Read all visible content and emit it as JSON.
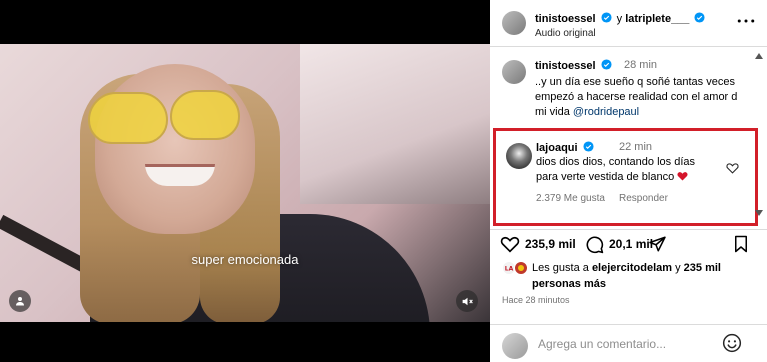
{
  "video": {
    "caption": "super emocionada",
    "user_button_icon": "user-icon",
    "mute_button_icon": "muted-speaker-icon"
  },
  "header": {
    "account_primary": "tinistoessel",
    "connector": "y",
    "account_secondary": "latriplete___",
    "audio": "Audio original",
    "more_icon": "more-horizontal-icon"
  },
  "caption_comment": {
    "username": "tinistoessel",
    "time": "28 min",
    "text": "..y un día ese sueño q soñé tantas veces empezó a hacerse realidad con el amor d mi vida",
    "mention": "@rodridepaul"
  },
  "highlighted_comment": {
    "username": "lajoaqui",
    "time": "22 min",
    "text": "dios dios dios, contando los días para verte vestida de blanco",
    "likes": "2.379 Me gusta",
    "reply_label": "Responder",
    "highlight_color": "#d21f29"
  },
  "actions": {
    "likes_count": "235,9 mil",
    "comments_count": "20,1 mil"
  },
  "likes_summary": {
    "prefix": "Les gusta a",
    "user": "elejercitodelam",
    "middle": "y",
    "others": "235 mil personas más"
  },
  "time_ago": "Hace 28 minutos",
  "add_comment": {
    "placeholder": "Agrega un comentario..."
  },
  "colors": {
    "verified_blue": "#0095f6",
    "mention": "#00376b",
    "muted_text": "#737373",
    "heart_red": "#d5162c"
  }
}
